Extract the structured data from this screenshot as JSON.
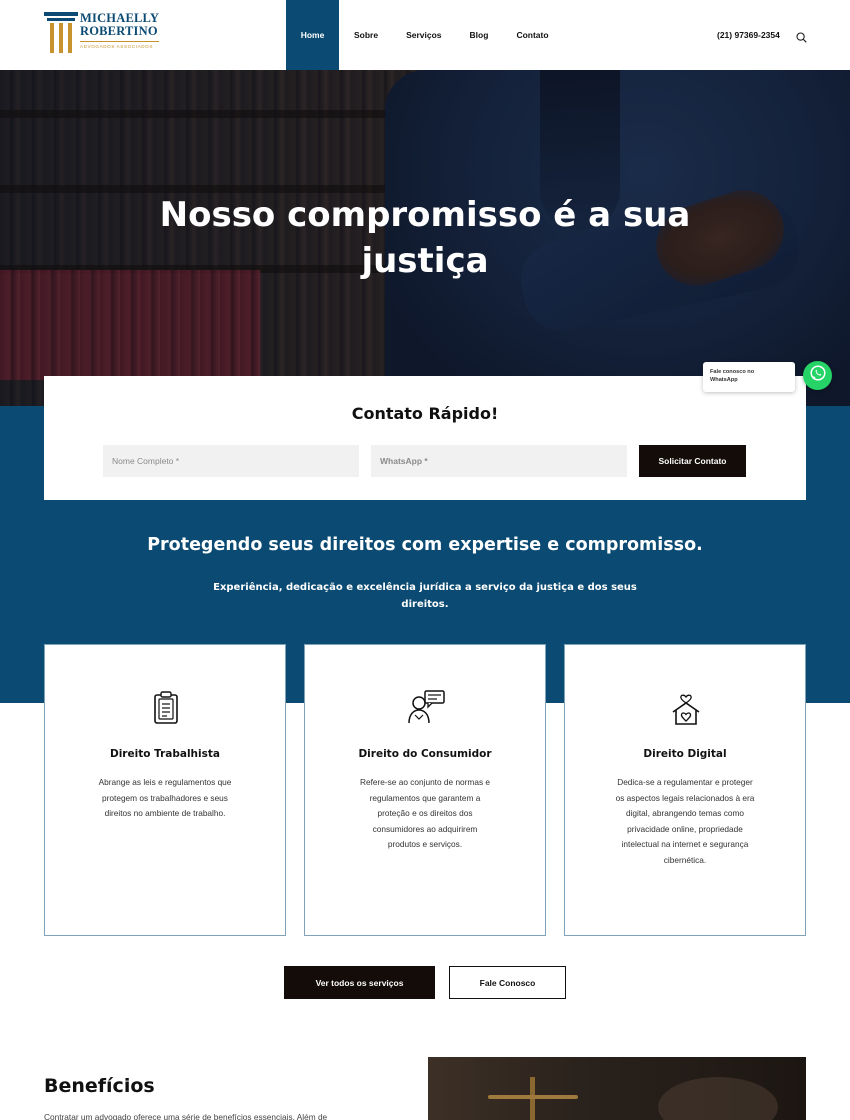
{
  "brand": {
    "name_line1": "MICHAELLY",
    "name_line2": "ROBERTINO",
    "tagline": "ADVOGADOS ASSOCIADOS",
    "primary_color": "#0b4a72",
    "accent_color": "#c8932f"
  },
  "nav": {
    "items": [
      {
        "label": "Home",
        "active": true
      },
      {
        "label": "Sobre",
        "active": false
      },
      {
        "label": "Serviços",
        "active": false
      },
      {
        "label": "Blog",
        "active": false
      },
      {
        "label": "Contato",
        "active": false
      }
    ],
    "phone": "(21) 97369-2354",
    "search_icon": "search-icon"
  },
  "hero": {
    "title_line1": "Nosso compromisso é a sua",
    "title_line2": "justiça"
  },
  "whatsapp": {
    "label_line1": "Fale conosco no",
    "label_line2": "WhatsApp",
    "icon": "whatsapp-icon",
    "color": "#25d366"
  },
  "contact": {
    "title": "Contato Rápido!",
    "name_placeholder": "Nome Completo *",
    "whatsapp_placeholder": "WhatsApp *",
    "submit_label": "Solicitar Contato"
  },
  "intro": {
    "heading": "Protegendo seus direitos com expertise e compromisso.",
    "sub_line1": "Experiência, dedicação e excelência jurídica a serviço da justiça e dos seus",
    "sub_line2": "direitos."
  },
  "services": [
    {
      "icon": "clipboard-icon",
      "title": "Direito Trabalhista",
      "lines": [
        "Abrange as leis e regulamentos que",
        "protegem os trabalhadores e seus",
        "direitos no ambiente de trabalho."
      ]
    },
    {
      "icon": "consumer-chat-icon",
      "title": "Direito do Consumidor",
      "lines": [
        "Refere-se ao conjunto de normas e",
        "regulamentos que garantem a",
        "proteção e os direitos dos",
        "consumidores ao adquirirem",
        "produtos e serviços."
      ]
    },
    {
      "icon": "home-heart-icon",
      "title": "Direito Digital",
      "lines": [
        "Dedica-se a regulamentar e proteger",
        "os aspectos legais relacionados à era",
        "digital, abrangendo temas como",
        "privacidade online, propriedade",
        "intelectual na internet e segurança",
        "cibernética."
      ]
    }
  ],
  "actions": {
    "all_services": "Ver todos os serviços",
    "contact_us": "Fale Conosco"
  },
  "benefits": {
    "title": "Benefícios",
    "text": "Contratar um advogado oferece uma série de benefícios essenciais. Além de"
  }
}
